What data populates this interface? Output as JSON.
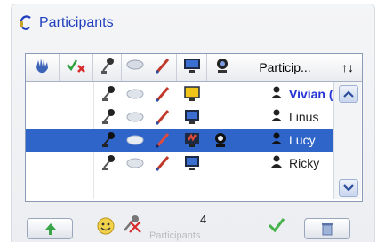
{
  "panel": {
    "title": "Participants",
    "title_icon": "headset-icon"
  },
  "grid": {
    "header": {
      "participants_label": "Particip...",
      "sort_label": "↑↓",
      "column_icons": [
        "hand-raise-icon",
        "checkmark-x-icon",
        "microphone-icon",
        "chat-bubble-icon",
        "pen-icon",
        "monitor-icon",
        "webcam-icon"
      ]
    },
    "rows": [
      {
        "name": "Vivian (...",
        "bold": true,
        "selected": false
      },
      {
        "name": "Linus",
        "bold": false,
        "selected": false
      },
      {
        "name": "Lucy",
        "bold": false,
        "selected": true
      },
      {
        "name": "Ricky",
        "bold": false,
        "selected": false
      }
    ]
  },
  "footer": {
    "count": "4",
    "faded_label": "Participants"
  },
  "colors": {
    "accent": "#1f3fbf",
    "selection": "#2f64c9",
    "presenter_name": "#2535d6"
  }
}
